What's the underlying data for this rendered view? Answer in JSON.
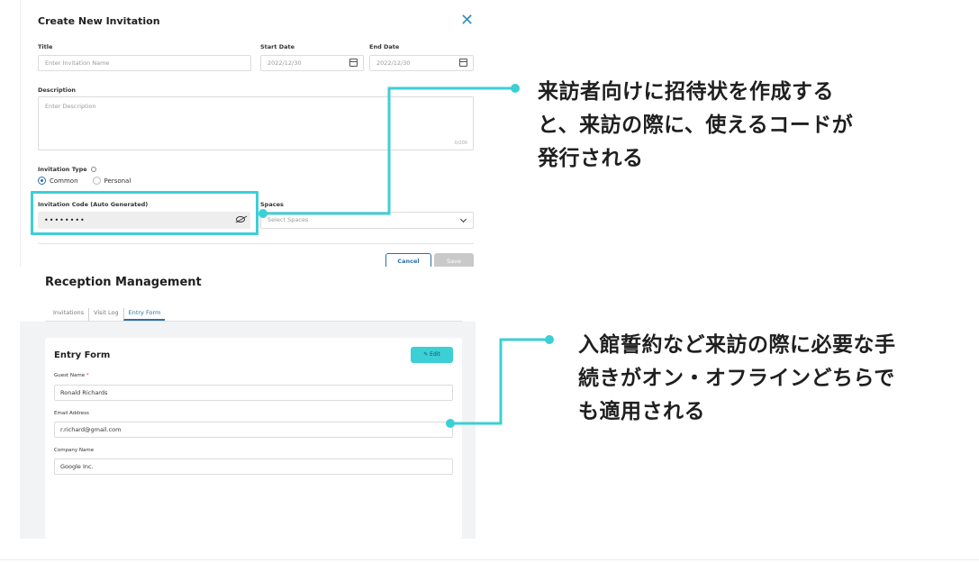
{
  "invitation_form": {
    "title": "Create New Invitation",
    "title_label": "Title",
    "title_placeholder": "Enter Invitation Name",
    "start_date_label": "Start Date",
    "start_date_value": "2022/12/30",
    "end_date_label": "End Date",
    "end_date_value": "2022/12/30",
    "description_label": "Description",
    "description_placeholder": "Enter Description",
    "description_counter": "0/200",
    "type_label": "Invitation Type",
    "type_options": [
      "Common",
      "Personal"
    ],
    "type_selected": "Common",
    "code_label": "Invitation Code (Auto Generated)",
    "code_value": "••••••••",
    "spaces_label": "Spaces",
    "spaces_placeholder": "Select Spaces",
    "cancel_label": "Cancel",
    "save_label": "Save"
  },
  "reception": {
    "title": "Reception Management",
    "tabs": [
      "Invitations",
      "Visit Log",
      "Entry Form"
    ],
    "active_tab": "Entry Form",
    "entry_form": {
      "title": "Entry Form",
      "edit_label": "Edit",
      "guest_name_label": "Guest Name",
      "guest_name_value": "Ronald Richards",
      "email_label": "Email Address",
      "email_value": "r.richard@gmail.com",
      "company_label": "Company Name",
      "company_value": "Google Inc."
    }
  },
  "callouts": {
    "first": [
      "来訪者向けに招待状を作成する",
      "と、来訪の際に、使えるコードが",
      "発行される"
    ],
    "second": [
      "入館誓約など来訪の際に必要な手",
      "続きがオン・オフラインどちらで",
      "も適用される"
    ]
  },
  "colors": {
    "accent": "#3ccfd6",
    "primary": "#2c6fa6"
  }
}
